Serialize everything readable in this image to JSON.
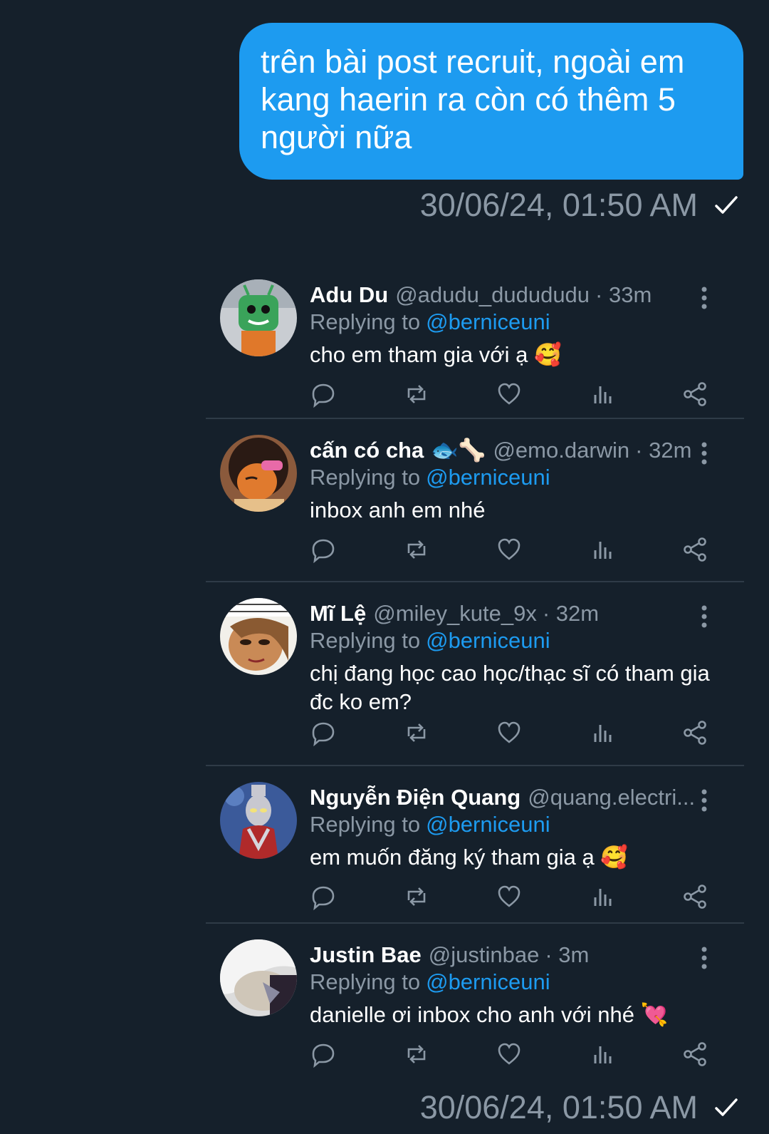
{
  "message": {
    "text": "trên bài post recruit, ngoài em kang haerin ra còn có thêm 5 người nữa",
    "timestamp": "30/06/24, 01:50 AM"
  },
  "card": {
    "replying_label": "Replying to",
    "mention": "@berniceuni",
    "replies": [
      {
        "name": "Adu Du",
        "handle": "@adudu_dudududu",
        "time": "· 33m",
        "text": "cho em tham gia với ạ 🥰"
      },
      {
        "name": "cấn có cha",
        "name_emoji": "🐟🦴",
        "handle": "@emo.darwin",
        "time": "· 32m",
        "text": "inbox anh em nhé"
      },
      {
        "name": "Mĩ Lệ",
        "handle": "@miley_kute_9x",
        "time": "· 32m",
        "text": "chị đang học cao học/thạc sĩ có tham gia đc ko em?"
      },
      {
        "name": "Nguyễn Điện Quang",
        "handle": "@quang.electri...",
        "time": "",
        "text": "em muốn đăng ký tham gia ạ 🥰"
      },
      {
        "name": "Justin Bae",
        "handle": "@justinbae",
        "time": "· 3m",
        "text": "danielle ơi inbox cho anh với nhé 💘"
      }
    ]
  },
  "footer_timestamp": "30/06/24, 01:50 AM",
  "colors": {
    "background": "#15202b",
    "bubble": "#1d9bf0",
    "muted": "#8b98a5",
    "accent": "#1d9bf0"
  },
  "icons": [
    "reply-icon",
    "retweet-icon",
    "like-icon",
    "views-icon",
    "share-icon",
    "more-icon",
    "check-icon"
  ]
}
